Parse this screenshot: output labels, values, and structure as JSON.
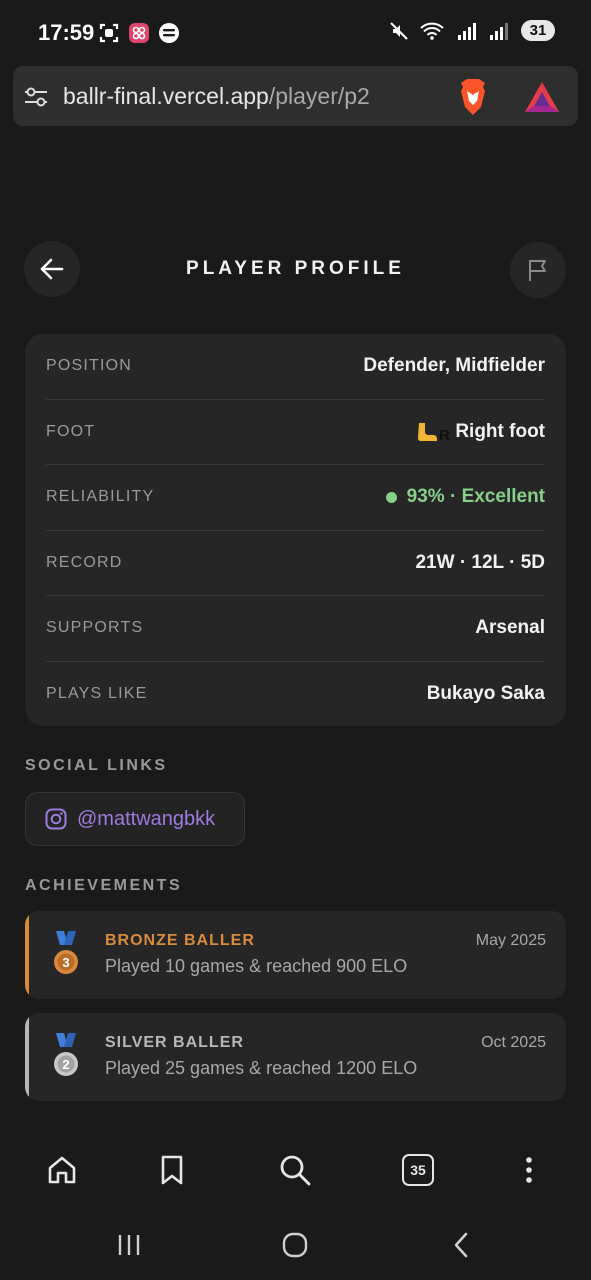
{
  "status_bar": {
    "time": "17:59",
    "battery": "31"
  },
  "browser": {
    "url_domain": "ballr-final.vercel.app",
    "url_path": "/player/p2",
    "tab_count": "35"
  },
  "header": {
    "title": "PLAYER PROFILE"
  },
  "profile": {
    "rows": [
      {
        "label": "POSITION",
        "value": "Defender, Midfielder"
      },
      {
        "label": "FOOT",
        "value": "Right foot"
      },
      {
        "label": "RELIABILITY",
        "value": "93% · Excellent"
      },
      {
        "label": "RECORD",
        "value": "21W · 12L · 5D"
      },
      {
        "label": "SUPPORTS",
        "value": "Arsenal"
      },
      {
        "label": "PLAYS LIKE",
        "value": "Bukayo Saka"
      }
    ],
    "reliability_color": "#86d08a"
  },
  "social": {
    "title": "SOCIAL LINKS",
    "instagram": "@mattwangbkk",
    "icon": "instagram-icon"
  },
  "achievements": {
    "title": "ACHIEVEMENTS",
    "items": [
      {
        "name": "BRONZE BALLER",
        "desc": "Played 10 games & reached 900 ELO",
        "date": "May 2025",
        "medal": "3",
        "color": "#d98a3d"
      },
      {
        "name": "SILVER BALLER",
        "desc": "Played 25 games & reached 1200 ELO",
        "date": "Oct 2025",
        "medal": "2",
        "color": "#b8b8b8"
      }
    ]
  },
  "colors": {
    "background": "#1a1a1a",
    "card": "#262626",
    "accent_purple": "#9d7be0"
  }
}
